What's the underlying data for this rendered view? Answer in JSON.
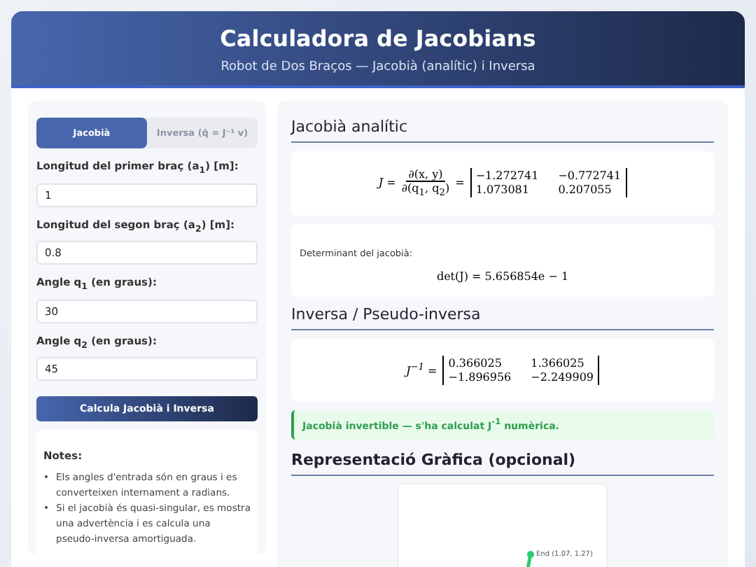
{
  "header": {
    "title": "Calculadora de Jacobians",
    "subtitle": "Robot de Dos Braços — Jacobià (analític) i Inversa"
  },
  "tabs": [
    {
      "label": "Jacobià",
      "selected": true
    },
    {
      "label": "Inversa (q̇ = J⁻¹ v)",
      "selected": false
    }
  ],
  "fields": [
    {
      "label": "Longitud del primer braç (a$_{1}$) [m]:",
      "value": "1"
    },
    {
      "label": "Longitud del segon braç (a$_{2}$) [m]:",
      "value": "0.8"
    },
    {
      "label": "Angle q$_{1}$ (en graus):",
      "value": "30"
    },
    {
      "label": "Angle q$_{2}$ (en graus):",
      "value": "45"
    }
  ],
  "calculate_button": "Calcula Jacobià i Inversa",
  "notes": {
    "title": "Notes:",
    "marker": "•",
    "items": [
      "Els angles d'entrada són en graus i es converteixen internament a radians.",
      "Si el jacobià és quasi-singular, es mostra una advertència i es calcula una pseudo-inversa amortiguada."
    ]
  },
  "jacobian": {
    "heading": "Jacobià analític",
    "lhs": "J =",
    "numerator": "∂(x, y)",
    "denominator": "∂(q$_{1}$, q$_{2}$)",
    "equals": "=",
    "matrix": [
      [
        "−1.272741",
        "−0.772741"
      ],
      [
        "1.073081",
        "0.207055"
      ]
    ]
  },
  "determinant": {
    "label": "Determinant del jacobià:",
    "formula": "det(J) = 5.656854e − 1"
  },
  "inverse": {
    "heading": "Inversa / Pseudo-inversa",
    "lhs": "J$^{−1}$ =",
    "matrix": [
      [
        "0.366025",
        "1.366025"
      ],
      [
        "−1.896956",
        "−2.249909"
      ]
    ]
  },
  "status": {
    "kind": "success",
    "text": "Jacobià invertible — s'ha calculat J$^{-1}$ numèrica."
  },
  "plot": {
    "heading": "Representació Gràfica (opcional)",
    "end_label": "End (1.07, 1.27)"
  }
}
